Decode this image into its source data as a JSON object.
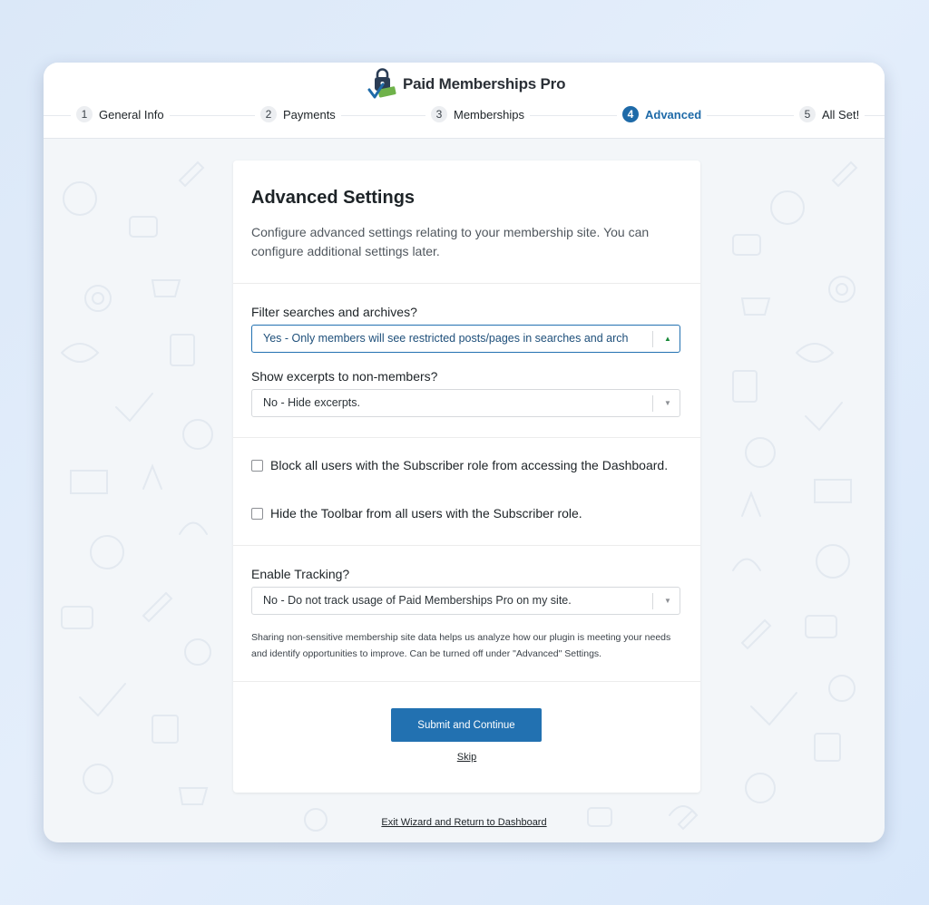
{
  "brand": {
    "name": "Paid Memberships Pro",
    "logo_icon": "pmpro-logo-icon"
  },
  "steps": [
    {
      "number": "1",
      "label": "General Info",
      "active": false
    },
    {
      "number": "2",
      "label": "Payments",
      "active": false
    },
    {
      "number": "3",
      "label": "Memberships",
      "active": false
    },
    {
      "number": "4",
      "label": "Advanced",
      "active": true
    },
    {
      "number": "5",
      "label": "All Set!",
      "active": false
    }
  ],
  "card": {
    "title": "Advanced Settings",
    "intro": "Configure advanced settings relating to your membership site. You can configure additional settings later.",
    "filter": {
      "label": "Filter searches and archives?",
      "value": "Yes - Only members will see restricted posts/pages in searches and arch"
    },
    "excerpts": {
      "label": "Show excerpts to non-members?",
      "value": "No - Hide excerpts."
    },
    "block_dashboard": {
      "label": "Block all users with the Subscriber role from accessing the Dashboard.",
      "checked": false
    },
    "hide_toolbar": {
      "label": "Hide the Toolbar from all users with the Subscriber role.",
      "checked": false
    },
    "tracking": {
      "label": "Enable Tracking?",
      "value": "No - Do not track usage of Paid Memberships Pro on my site.",
      "help": "Sharing non-sensitive membership site data helps us analyze how our plugin is meeting your needs and identify opportunities to improve. Can be turned off under \"Advanced\" Settings."
    },
    "submit_label": "Submit and Continue",
    "skip_label": "Skip"
  },
  "exit_label": "Exit Wizard and Return to Dashboard",
  "colors": {
    "accent": "#2271b1",
    "active_step": "#1e6aa8",
    "background": "#dbe8f8",
    "card": "#ffffff"
  }
}
